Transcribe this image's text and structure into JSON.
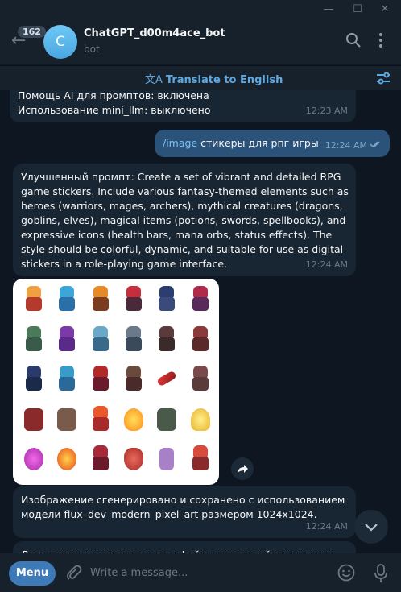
{
  "header": {
    "badge_count": "162",
    "avatar_letter": "C",
    "title": "ChatGPT_d00m4ace_bot",
    "subtitle": "bot"
  },
  "translate": {
    "label": "Translate to English"
  },
  "messages": [
    {
      "lines": [
        "Помощь AI для промптов: включена",
        "Использование mini_llm: выключено"
      ],
      "time": "12:23 AM"
    },
    {
      "command": "/image",
      "text": " стикеры для рпг игры",
      "time": "12:24 AM"
    },
    {
      "text": "Улучшенный промпт: Create a set of vibrant and detailed RPG game stickers. Include various fantasy-themed elements such as heroes (warriors, mages, archers), mythical creatures (dragons, goblins, elves), magical items (potions, swords, spellbooks), and expressive icons (health bars, mana orbs, status effects). The style should be colorful, dynamic, and suitable for use as digital stickers in a role-playing game interface.",
      "time": "12:24 AM"
    },
    {
      "text": "Изображение сгенерировано и сохранено с использованием модели flux_dev_modern_pixel_art размером 1024x1024.",
      "time": "12:24 AM"
    },
    {
      "text": "Для загрузки исходного .png файла используйте команду"
    }
  ],
  "input": {
    "menu_label": "Menu",
    "placeholder": "Write a message..."
  },
  "colors": {
    "background": "#0e1621",
    "header": "#17212b",
    "incoming_bubble": "#182533",
    "outgoing_bubble": "#2b5278",
    "accent": "#5fa8e0",
    "menu_button": "#3e7ab8"
  },
  "icons": [
    "minimize-icon",
    "maximize-icon",
    "close-icon",
    "back-arrow-icon",
    "search-icon",
    "more-vertical-icon",
    "translate-icon",
    "filter-icon",
    "double-check-icon",
    "share-icon",
    "chevron-down-icon",
    "paperclip-icon",
    "emoji-icon",
    "microphone-icon"
  ]
}
